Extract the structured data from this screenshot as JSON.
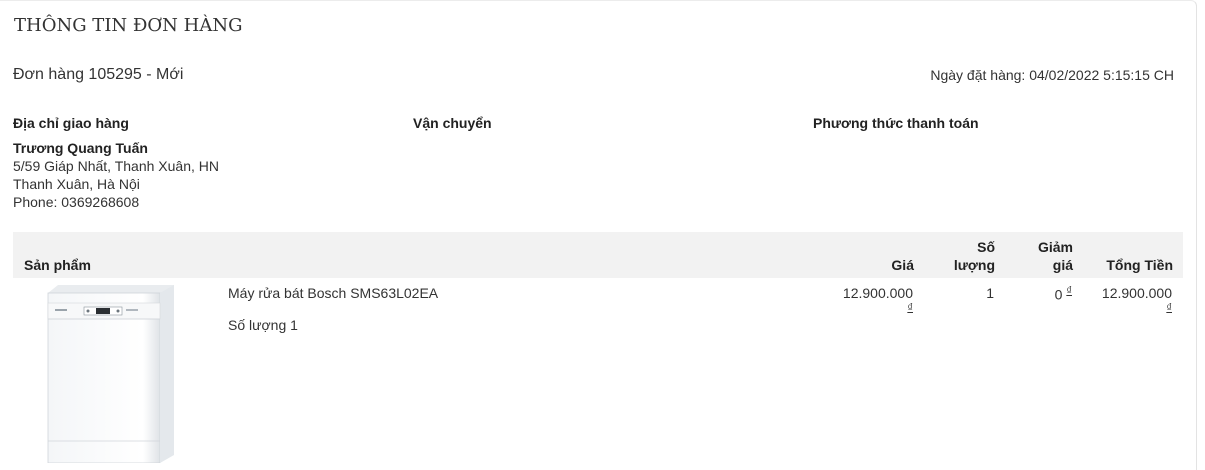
{
  "page": {
    "title": "THÔNG TIN ĐƠN HÀNG"
  },
  "order": {
    "title": "Đơn hàng 105295 - Mới",
    "date": "Ngày đặt hàng: 04/02/2022 5:15:15 CH"
  },
  "sections": {
    "shipping_address_label": "Địa chỉ giao hàng",
    "shipping_method_label": "Vận chuyển",
    "payment_method_label": "Phương thức thanh toán"
  },
  "address": {
    "name": "Trương Quang Tuấn",
    "line1": "5/59 Giáp Nhất, Thanh Xuân, HN",
    "line2": "Thanh Xuân, Hà Nội",
    "phone": "Phone: 0369268608"
  },
  "table": {
    "headers": {
      "product": "Sản phẩm",
      "price": "Giá",
      "qty_line1": "Số",
      "qty_line2": "lượng",
      "discount_line1": "Giảm",
      "discount_line2": "giá",
      "total": "Tổng Tiền"
    },
    "rows": [
      {
        "name": "Máy rửa bát Bosch SMS63L02EA",
        "quantity_note": "Số lượng 1",
        "price": "12.900.000",
        "price_currency": "₫",
        "qty": "1",
        "discount": "0",
        "discount_currency": "₫",
        "total": "12.900.000",
        "total_currency": "₫",
        "image_icon": "dishwasher-image"
      }
    ]
  }
}
